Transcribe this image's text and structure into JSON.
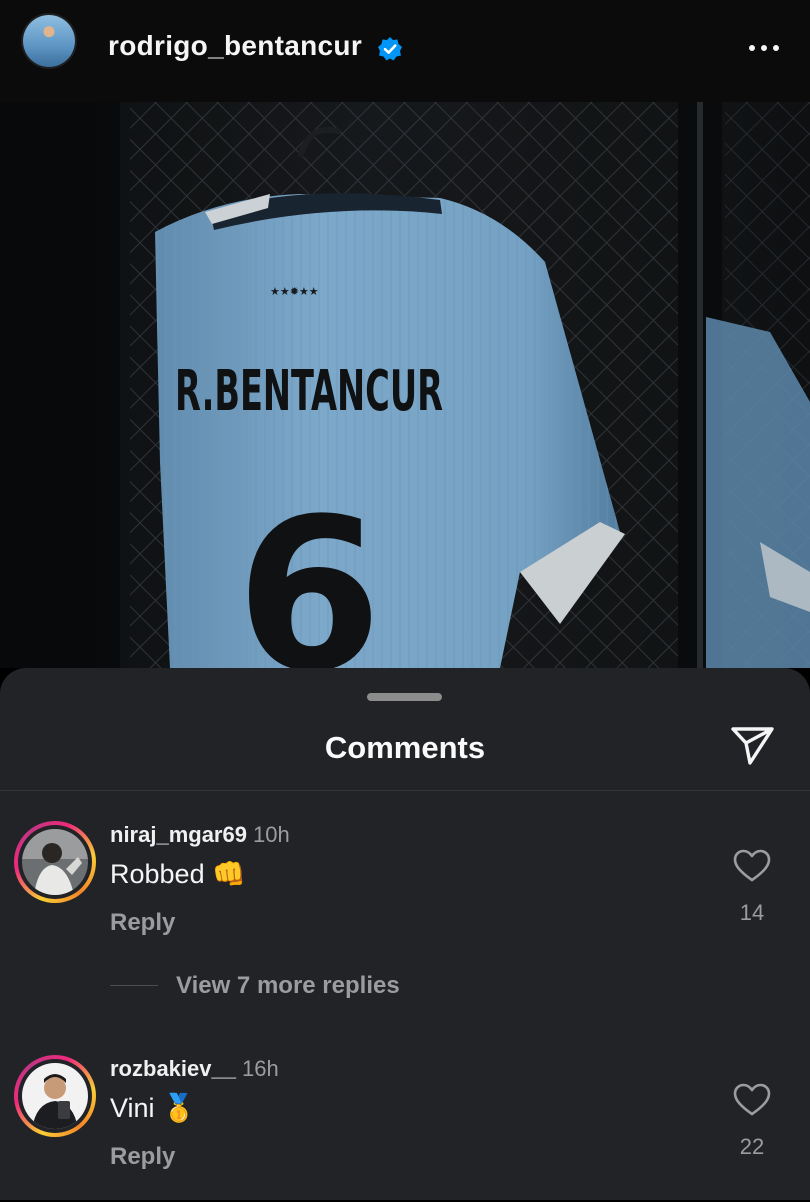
{
  "header": {
    "username": "rodrigo_bentancur",
    "verified_icon": "verified-badge-icon",
    "more_icon": "more-horizontal-icon"
  },
  "post_image": {
    "jersey_name": "R.BENTANCUR",
    "jersey_number": "6"
  },
  "comments_sheet": {
    "title": "Comments",
    "share_icon": "paper-plane-icon"
  },
  "comments": [
    {
      "username": "niraj_mgar69",
      "time": "10h",
      "text": "Robbed 👊",
      "reply_label": "Reply",
      "likes": "14",
      "view_more_replies": "View 7 more replies"
    },
    {
      "username": "rozbakiev__",
      "time": "16h",
      "text": "Vini 🥇",
      "reply_label": "Reply",
      "likes": "22"
    }
  ],
  "colors": {
    "sheet_background": "#212327",
    "muted_text": "#9a9ca0",
    "verified_blue": "#0095f6",
    "jersey_blue": "#8ec0e6"
  }
}
